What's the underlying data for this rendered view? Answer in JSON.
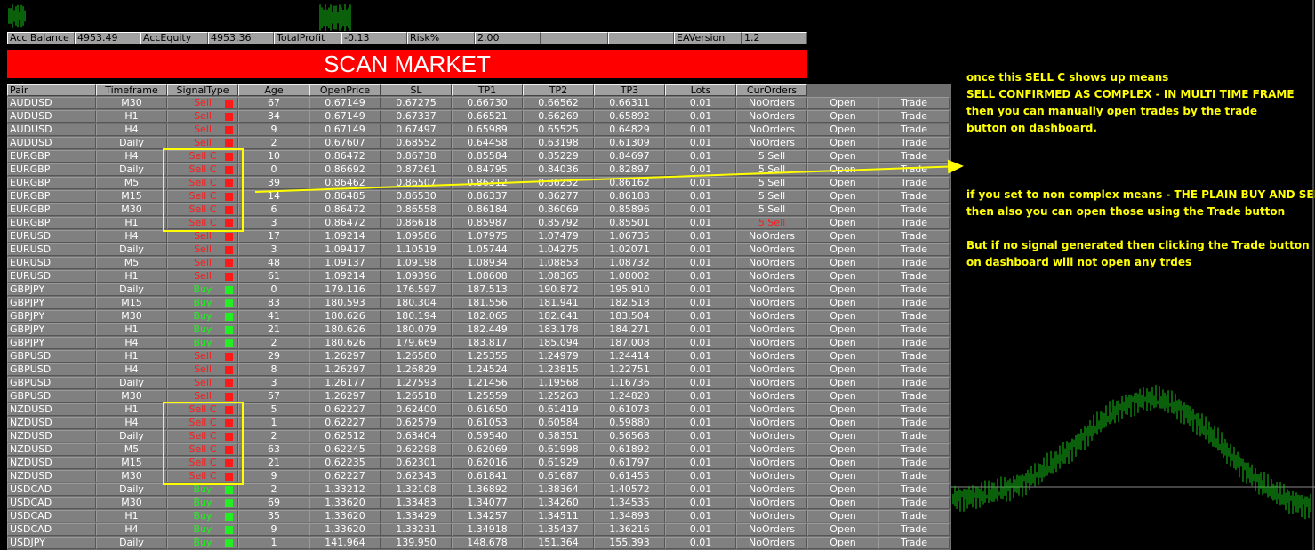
{
  "header": {
    "acc_balance_label": "Acc Balance",
    "acc_balance_value": "4953.49",
    "acc_equity_label": "AccEquity",
    "acc_equity_value": "4953.36",
    "total_profit_label": "TotalProfit",
    "total_profit_value": "-0.13",
    "risk_label": "Risk%",
    "risk_value": "2.00",
    "ea_version_label": "EAVersion",
    "ea_version_value": "1.2"
  },
  "scan_button_label": "SCAN MARKET",
  "columns": [
    "Pair",
    "Timeframe",
    "SignalType",
    "Age",
    "OpenPrice",
    "SL",
    "TP1",
    "TP2",
    "TP3",
    "Lots",
    "CurOrders"
  ],
  "open_label": "Open",
  "trade_label": "Trade",
  "rows": [
    [
      "AUDUSD",
      "M30",
      "Sell",
      "67",
      "0.67149",
      "0.67275",
      "0.66730",
      "0.66562",
      "0.66311",
      "0.01",
      "NoOrders"
    ],
    [
      "AUDUSD",
      "H1",
      "Sell",
      "34",
      "0.67149",
      "0.67337",
      "0.66521",
      "0.66269",
      "0.65892",
      "0.01",
      "NoOrders"
    ],
    [
      "AUDUSD",
      "H4",
      "Sell",
      "9",
      "0.67149",
      "0.67497",
      "0.65989",
      "0.65525",
      "0.64829",
      "0.01",
      "NoOrders"
    ],
    [
      "AUDUSD",
      "Daily",
      "Sell",
      "2",
      "0.67607",
      "0.68552",
      "0.64458",
      "0.63198",
      "0.61309",
      "0.01",
      "NoOrders"
    ],
    [
      "EURGBP",
      "H4",
      "Sell C",
      "10",
      "0.86472",
      "0.86738",
      "0.85584",
      "0.85229",
      "0.84697",
      "0.01",
      "5 Sell"
    ],
    [
      "EURGBP",
      "Daily",
      "Sell C",
      "0",
      "0.86692",
      "0.87261",
      "0.84795",
      "0.84036",
      "0.82897",
      "0.01",
      "5 Sell"
    ],
    [
      "EURGBP",
      "M5",
      "Sell C",
      "39",
      "0.86462",
      "0.86507",
      "0.86312",
      "0.86252",
      "0.86162",
      "0.01",
      "5 Sell"
    ],
    [
      "EURGBP",
      "M15",
      "Sell C",
      "14",
      "0.86485",
      "0.86530",
      "0.86337",
      "0.86277",
      "0.86188",
      "0.01",
      "5 Sell"
    ],
    [
      "EURGBP",
      "M30",
      "Sell C",
      "6",
      "0.86472",
      "0.86558",
      "0.86184",
      "0.86069",
      "0.85896",
      "0.01",
      "5 Sell"
    ],
    [
      "EURGBP",
      "H1",
      "Sell C",
      "3",
      "0.86472",
      "0.86618",
      "0.85987",
      "0.85792",
      "0.85501",
      "0.01",
      "5 Sell"
    ],
    [
      "EURUSD",
      "H4",
      "Sell",
      "17",
      "1.09214",
      "1.09586",
      "1.07975",
      "1.07479",
      "1.06735",
      "0.01",
      "NoOrders"
    ],
    [
      "EURUSD",
      "Daily",
      "Sell",
      "3",
      "1.09417",
      "1.10519",
      "1.05744",
      "1.04275",
      "1.02071",
      "0.01",
      "NoOrders"
    ],
    [
      "EURUSD",
      "M5",
      "Sell",
      "48",
      "1.09137",
      "1.09198",
      "1.08934",
      "1.08853",
      "1.08732",
      "0.01",
      "NoOrders"
    ],
    [
      "EURUSD",
      "H1",
      "Sell",
      "61",
      "1.09214",
      "1.09396",
      "1.08608",
      "1.08365",
      "1.08002",
      "0.01",
      "NoOrders"
    ],
    [
      "GBPJPY",
      "Daily",
      "Buy",
      "0",
      "179.116",
      "176.597",
      "187.513",
      "190.872",
      "195.910",
      "0.01",
      "NoOrders"
    ],
    [
      "GBPJPY",
      "M15",
      "Buy",
      "83",
      "180.593",
      "180.304",
      "181.556",
      "181.941",
      "182.518",
      "0.01",
      "NoOrders"
    ],
    [
      "GBPJPY",
      "M30",
      "Buy",
      "41",
      "180.626",
      "180.194",
      "182.065",
      "182.641",
      "183.504",
      "0.01",
      "NoOrders"
    ],
    [
      "GBPJPY",
      "H1",
      "Buy",
      "21",
      "180.626",
      "180.079",
      "182.449",
      "183.178",
      "184.271",
      "0.01",
      "NoOrders"
    ],
    [
      "GBPJPY",
      "H4",
      "Buy",
      "2",
      "180.626",
      "179.669",
      "183.817",
      "185.094",
      "187.008",
      "0.01",
      "NoOrders"
    ],
    [
      "GBPUSD",
      "H1",
      "Sell",
      "29",
      "1.26297",
      "1.26580",
      "1.25355",
      "1.24979",
      "1.24414",
      "0.01",
      "NoOrders"
    ],
    [
      "GBPUSD",
      "H4",
      "Sell",
      "8",
      "1.26297",
      "1.26829",
      "1.24524",
      "1.23815",
      "1.22751",
      "0.01",
      "NoOrders"
    ],
    [
      "GBPUSD",
      "Daily",
      "Sell",
      "3",
      "1.26177",
      "1.27593",
      "1.21456",
      "1.19568",
      "1.16736",
      "0.01",
      "NoOrders"
    ],
    [
      "GBPUSD",
      "M30",
      "Sell",
      "57",
      "1.26297",
      "1.26518",
      "1.25559",
      "1.25263",
      "1.24820",
      "0.01",
      "NoOrders"
    ],
    [
      "NZDUSD",
      "H1",
      "Sell C",
      "5",
      "0.62227",
      "0.62400",
      "0.61650",
      "0.61419",
      "0.61073",
      "0.01",
      "NoOrders"
    ],
    [
      "NZDUSD",
      "H4",
      "Sell C",
      "1",
      "0.62227",
      "0.62579",
      "0.61053",
      "0.60584",
      "0.59880",
      "0.01",
      "NoOrders"
    ],
    [
      "NZDUSD",
      "Daily",
      "Sell C",
      "2",
      "0.62512",
      "0.63404",
      "0.59540",
      "0.58351",
      "0.56568",
      "0.01",
      "NoOrders"
    ],
    [
      "NZDUSD",
      "M5",
      "Sell C",
      "63",
      "0.62245",
      "0.62298",
      "0.62069",
      "0.61998",
      "0.61892",
      "0.01",
      "NoOrders"
    ],
    [
      "NZDUSD",
      "M15",
      "Sell C",
      "21",
      "0.62235",
      "0.62301",
      "0.62016",
      "0.61929",
      "0.61797",
      "0.01",
      "NoOrders"
    ],
    [
      "NZDUSD",
      "M30",
      "Sell C",
      "9",
      "0.62227",
      "0.62343",
      "0.61841",
      "0.61687",
      "0.61455",
      "0.01",
      "NoOrders"
    ],
    [
      "USDCAD",
      "Daily",
      "Buy",
      "2",
      "1.33212",
      "1.32108",
      "1.36892",
      "1.38364",
      "1.40572",
      "0.01",
      "NoOrders"
    ],
    [
      "USDCAD",
      "M30",
      "Buy",
      "69",
      "1.33620",
      "1.33483",
      "1.34077",
      "1.34260",
      "1.34535",
      "0.01",
      "NoOrders"
    ],
    [
      "USDCAD",
      "H1",
      "Buy",
      "35",
      "1.33620",
      "1.33429",
      "1.34257",
      "1.34511",
      "1.34893",
      "0.01",
      "NoOrders"
    ],
    [
      "USDCAD",
      "H4",
      "Buy",
      "9",
      "1.33620",
      "1.33231",
      "1.34918",
      "1.35437",
      "1.36216",
      "0.01",
      "NoOrders"
    ],
    [
      "USDJPY",
      "Daily",
      "Buy",
      "1",
      "141.964",
      "139.950",
      "148.678",
      "151.364",
      "155.393",
      "0.01",
      "NoOrders"
    ]
  ],
  "alert_order_row": 9,
  "highlight_groups": [
    [
      4,
      9
    ],
    [
      23,
      28
    ]
  ],
  "colors": {
    "sell": "#ff1a1a",
    "buy": "#22ee22",
    "annotation": "#ffff00",
    "scan_bg": "#ff0000"
  },
  "annotations": {
    "note1_line1": "once this SELL C shows up means",
    "note1_line2": "SELL CONFIRMED AS COMPLEX - IN MULTI TIME FRAME",
    "note1_line3": "then you can manually open trades by the trade",
    "note1_line4": "button on dashboard.",
    "note2_line1": "if you set to non complex means - THE PLAIN BUY AND SELL",
    "note2_line2": "then also you can open those using the Trade button",
    "note3_line1": "But if no signal generated then clicking the Trade button",
    "note3_line2": "on dashboard will not open any trdes"
  }
}
